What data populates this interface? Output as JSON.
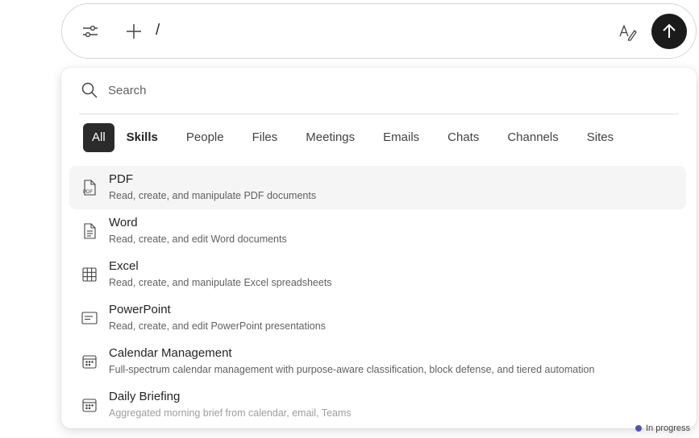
{
  "composer": {
    "input_value": "/",
    "icons": {
      "tune": "tune-icon",
      "add": "plus-icon",
      "style": "text-style-icon",
      "send": "arrow-up-icon"
    }
  },
  "picker": {
    "search": {
      "placeholder": "Search"
    },
    "tabs": [
      {
        "label": "All",
        "active": true
      },
      {
        "label": "Skills",
        "bold": true
      },
      {
        "label": "People"
      },
      {
        "label": "Files"
      },
      {
        "label": "Meetings"
      },
      {
        "label": "Emails"
      },
      {
        "label": "Chats"
      },
      {
        "label": "Channels"
      },
      {
        "label": "Sites"
      }
    ],
    "items": [
      {
        "title": "PDF",
        "description": "Read, create, and manipulate PDF documents",
        "icon": "pdf-file-icon"
      },
      {
        "title": "Word",
        "description": "Read, create, and edit Word documents",
        "icon": "document-icon"
      },
      {
        "title": "Excel",
        "description": "Read, create, and manipulate Excel spreadsheets",
        "icon": "table-grid-icon"
      },
      {
        "title": "PowerPoint",
        "description": "Read, create, and edit PowerPoint presentations",
        "icon": "slides-icon"
      },
      {
        "title": "Calendar Management",
        "description": "Full-spectrum calendar management with purpose-aware classification, block defense, and tiered automation",
        "icon": "calendar-icon"
      },
      {
        "title": "Daily Briefing",
        "description": "Aggregated morning brief from calendar, email, Teams",
        "icon": "calendar-icon"
      }
    ]
  },
  "background": {
    "status_text": "In progress"
  },
  "colors": {
    "send_button": "#1b1b1b",
    "active_tab": "#2b2b2b",
    "hover_row": "#f5f5f5",
    "status_dot": "#4f52b2"
  }
}
